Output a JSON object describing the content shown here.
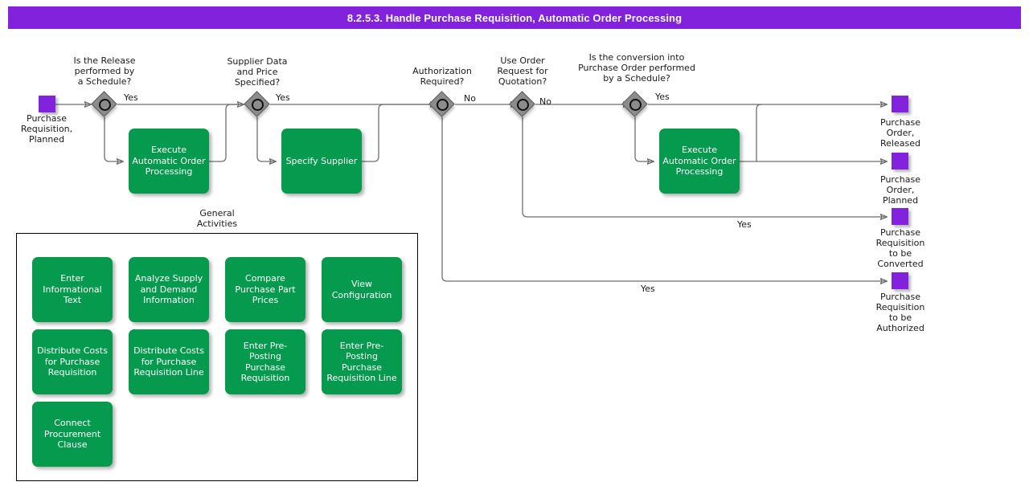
{
  "title": "8.2.5.3. Handle Purchase Requisition, Automatic Order Processing",
  "colors": {
    "title_bar": "#8222dd",
    "event": "#8222dd",
    "task": "#069a4e",
    "gateway": "#8c8c8c",
    "connector": "#6e6e6e"
  },
  "start_event": {
    "label": "Purchase\nRequisition,\nPlanned"
  },
  "gateways": [
    {
      "id": "g1",
      "label": "Is the Release\nperformed by\na Schedule?",
      "branch_label": "Yes"
    },
    {
      "id": "g2",
      "label": "Supplier Data\nand Price\nSpecified?",
      "branch_label": "Yes"
    },
    {
      "id": "g3",
      "label": "Authorization\nRequired?",
      "branch_label": "No"
    },
    {
      "id": "g4",
      "label": "Use Order\nRequest for\nQuotation?",
      "branch_label": "No"
    },
    {
      "id": "g5",
      "label": "Is the conversion into\nPurchase Order performed\nby a Schedule?",
      "branch_label": "Yes"
    }
  ],
  "tasks": [
    {
      "id": "t1",
      "label": "Execute\nAutomatic Order\nProcessing"
    },
    {
      "id": "t2",
      "label": "Specify Supplier"
    },
    {
      "id": "t3",
      "label": "Execute\nAutomatic Order\nProcessing"
    }
  ],
  "edge_labels": [
    {
      "id": "e1",
      "text": "Yes"
    },
    {
      "id": "e2",
      "text": "Yes"
    },
    {
      "id": "e3",
      "text": "No"
    },
    {
      "id": "e4",
      "text": "No"
    },
    {
      "id": "e5",
      "text": "Yes"
    },
    {
      "id": "e6",
      "text": "Yes"
    },
    {
      "id": "e7",
      "text": "Yes"
    }
  ],
  "end_events": [
    {
      "id": "end1",
      "label": "Purchase\nOrder,\nReleased"
    },
    {
      "id": "end2",
      "label": "Purchase\nOrder,\nPlanned"
    },
    {
      "id": "end3",
      "label": "Purchase\nRequisition\nto be\nConverted"
    },
    {
      "id": "end4",
      "label": "Purchase\nRequisition\nto be\nAuthorized"
    }
  ],
  "general_activities": {
    "title": "General\nActivities",
    "items": [
      {
        "id": "ga1",
        "label": "Enter\nInformational\nText"
      },
      {
        "id": "ga2",
        "label": "Analyze Supply\nand Demand\nInformation"
      },
      {
        "id": "ga3",
        "label": "Compare\nPurchase Part\nPrices"
      },
      {
        "id": "ga4",
        "label": "View\nConfiguration"
      },
      {
        "id": "ga5",
        "label": "Distribute Costs\nfor Purchase\nRequisition"
      },
      {
        "id": "ga6",
        "label": "Distribute Costs\nfor Purchase\nRequisition Line"
      },
      {
        "id": "ga7",
        "label": "Enter Pre-\nPosting\nPurchase\nRequisition"
      },
      {
        "id": "ga8",
        "label": "Enter Pre-\nPosting\nPurchase\nRequisition Line"
      },
      {
        "id": "ga9",
        "label": "Connect\nProcurement\nClause"
      }
    ]
  }
}
